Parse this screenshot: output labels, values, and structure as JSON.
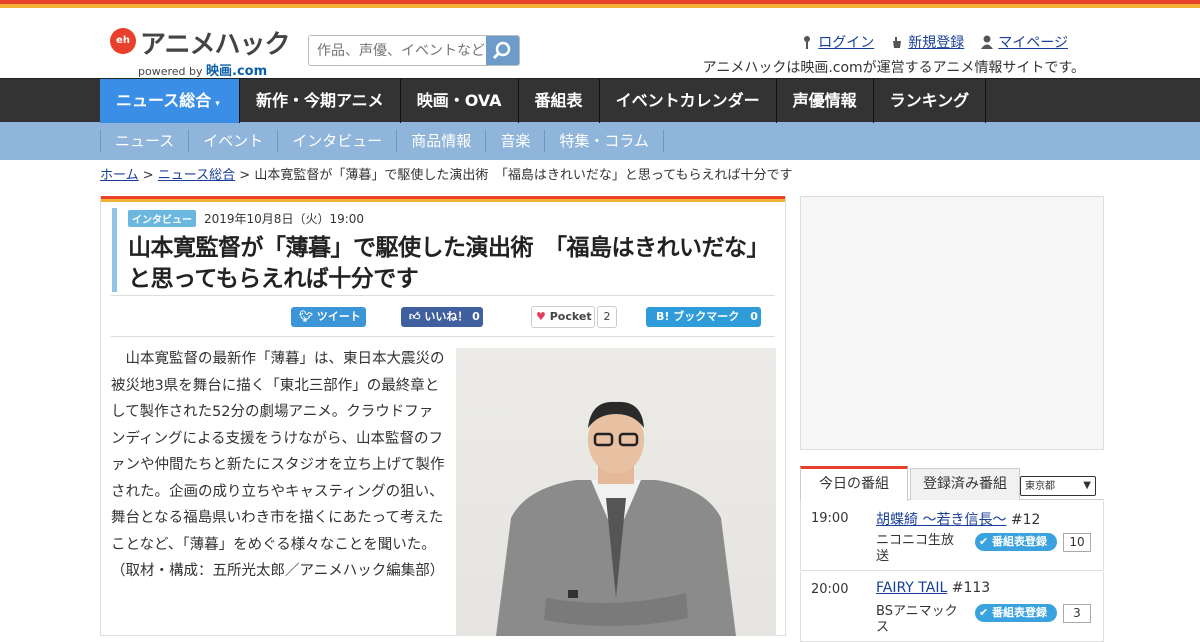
{
  "header": {
    "logo_text": "アニメハック",
    "logo_mark": "eh",
    "powered_by": "powered by",
    "powered_brand": "映画.com",
    "search_placeholder": "作品、声優、イベントなど",
    "links": [
      {
        "label": "ログイン",
        "icon": "key-icon"
      },
      {
        "label": "新規登録",
        "icon": "hand-icon"
      },
      {
        "label": "マイページ",
        "icon": "user-icon"
      }
    ],
    "tagline": "アニメハックは映画.comが運営するアニメ情報サイトです。"
  },
  "nav": {
    "items": [
      "ニュース総合",
      "新作・今期アニメ",
      "映画・OVA",
      "番組表",
      "イベントカレンダー",
      "声優情報",
      "ランキング"
    ],
    "active_marker": "▾"
  },
  "subnav": {
    "items": [
      "ニュース",
      "イベント",
      "インタビュー",
      "商品情報",
      "音楽",
      "特集・コラム"
    ]
  },
  "breadcrumb": {
    "home": "ホーム",
    "section": "ニュース総合",
    "sep": " > ",
    "current": "山本寛監督が「薄暮」で駆使した演出術　「福島はきれいだな」と思ってもらえれば十分です"
  },
  "article": {
    "badge": "インタビュー",
    "date": "2019年10月8日（火）19:00",
    "title": "山本寛監督が「薄暮」で駆使した演出術　「福島はきれいだな」と思ってもらえれば十分です",
    "share": {
      "tweet": "ツイート",
      "like": "いいね！ 0",
      "pocket": "Pocket",
      "pocket_count": "2",
      "hatena": "B! ブックマーク　0"
    },
    "body": "山本寛監督の最新作「薄暮」は、東日本大震災の被災地3県を舞台に描く「東北三部作」の最終章として製作された52分の劇場アニメ。クラウドファンディングによる支援をうけながら、山本監督のファンや仲間たちと新たにスタジオを立ち上げて製作された。企画の成り立ちやキャスティングの狙い、舞台となる福島県いわき市を描くにあたって考えたことなど、「薄暮」をめぐる様々なことを聞いた。（取材・構成：五所光太郎／アニメハック編集部）"
  },
  "tv": {
    "tab_today": "今日の番組",
    "tab_registered": "登録済み番組",
    "prefecture": "東京都",
    "register_label": "番組表登録",
    "programs": [
      {
        "time": "19:00",
        "title": "胡蝶綺 ～若き信長～",
        "episode": "#12",
        "channel": "ニコニコ生放送",
        "count": "10"
      },
      {
        "time": "20:00",
        "title": "FAIRY TAIL",
        "episode": "#113",
        "channel": "BSアニマックス",
        "count": "3"
      }
    ]
  },
  "colors": {
    "accent_red": "#e8402a",
    "accent_yellow": "#f2b134",
    "nav_active": "#3a8ee6",
    "subnav": "#8fb5da"
  }
}
